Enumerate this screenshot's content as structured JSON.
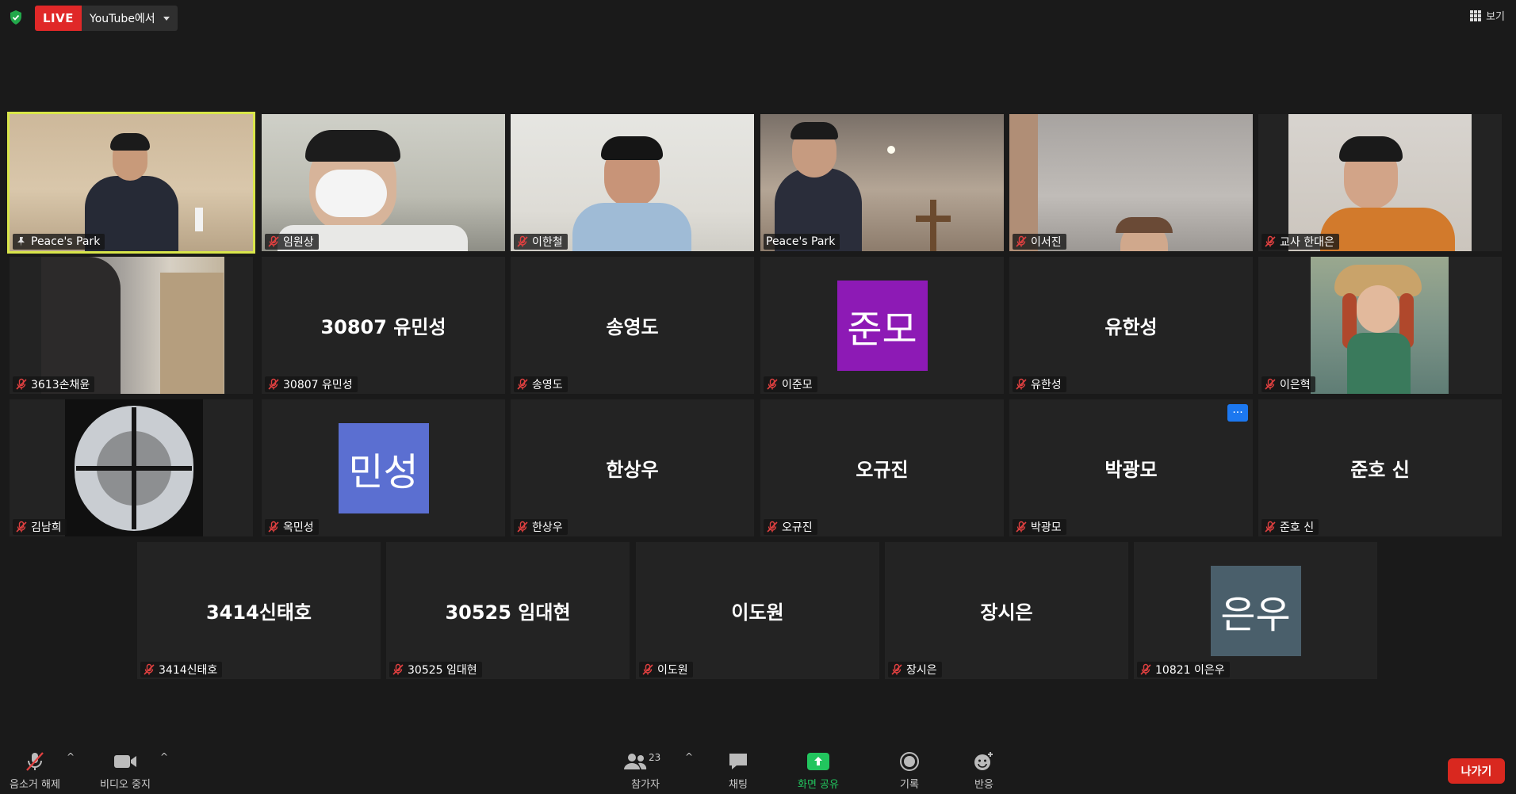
{
  "topbar": {
    "live_label": "LIVE",
    "live_destination": "YouTube에서",
    "view_label": "보기"
  },
  "colors": {
    "active_speaker_border": "#d9e64a",
    "live_red": "#e02828",
    "avatar_purple": "#8d1ab5",
    "avatar_blue": "#5b6fd1",
    "avatar_slate": "#4a5f6b",
    "share_green": "#22c55e",
    "leave_red": "#d9281f"
  },
  "tiles": {
    "r1c1": {
      "tag": "Peace's Park"
    },
    "r1c2": {
      "tag": "임원상"
    },
    "r1c3": {
      "tag": "이한철"
    },
    "r1c4": {
      "tag": "Peace's Park"
    },
    "r1c5": {
      "tag": "이서진"
    },
    "r1c6": {
      "tag": "교사 한대은"
    },
    "r2c1": {
      "tag": "3613손채윤"
    },
    "r2c2": {
      "display": "30807 유민성",
      "tag": "30807 유민성"
    },
    "r2c3": {
      "display": "송영도",
      "tag": "송영도"
    },
    "r2c4": {
      "avatar": "준모",
      "tag": "이준모"
    },
    "r2c5": {
      "display": "유한성",
      "tag": "유한성"
    },
    "r2c6": {
      "tag": "이은혁"
    },
    "r3c1": {
      "tag": "김남희"
    },
    "r3c2": {
      "avatar": "민성",
      "tag": "옥민성"
    },
    "r3c3": {
      "display": "한상우",
      "tag": "한상우"
    },
    "r3c4": {
      "display": "오규진",
      "tag": "오규진"
    },
    "r3c5": {
      "display": "박광모",
      "tag": "박광모",
      "more": "···"
    },
    "r3c6": {
      "display": "준호 신",
      "tag": "준호 신"
    },
    "r4c1": {
      "display": "3414신태호",
      "tag": "3414신태호"
    },
    "r4c2": {
      "display": "30525 임대현",
      "tag": "30525 임대현"
    },
    "r4c3": {
      "display": "이도원",
      "tag": "이도원"
    },
    "r4c4": {
      "display": "장시은",
      "tag": "장시은"
    },
    "r4c5": {
      "avatar": "은우",
      "tag": "10821 이은우"
    }
  },
  "toolbar": {
    "unmute_label": "음소거 해제",
    "video_label": "비디오 중지",
    "participants_label": "참가자",
    "participants_count": "23",
    "chat_label": "채팅",
    "share_label": "화면 공유",
    "record_label": "기록",
    "reactions_label": "반응",
    "leave_label": "나가기",
    "caret": "^"
  }
}
